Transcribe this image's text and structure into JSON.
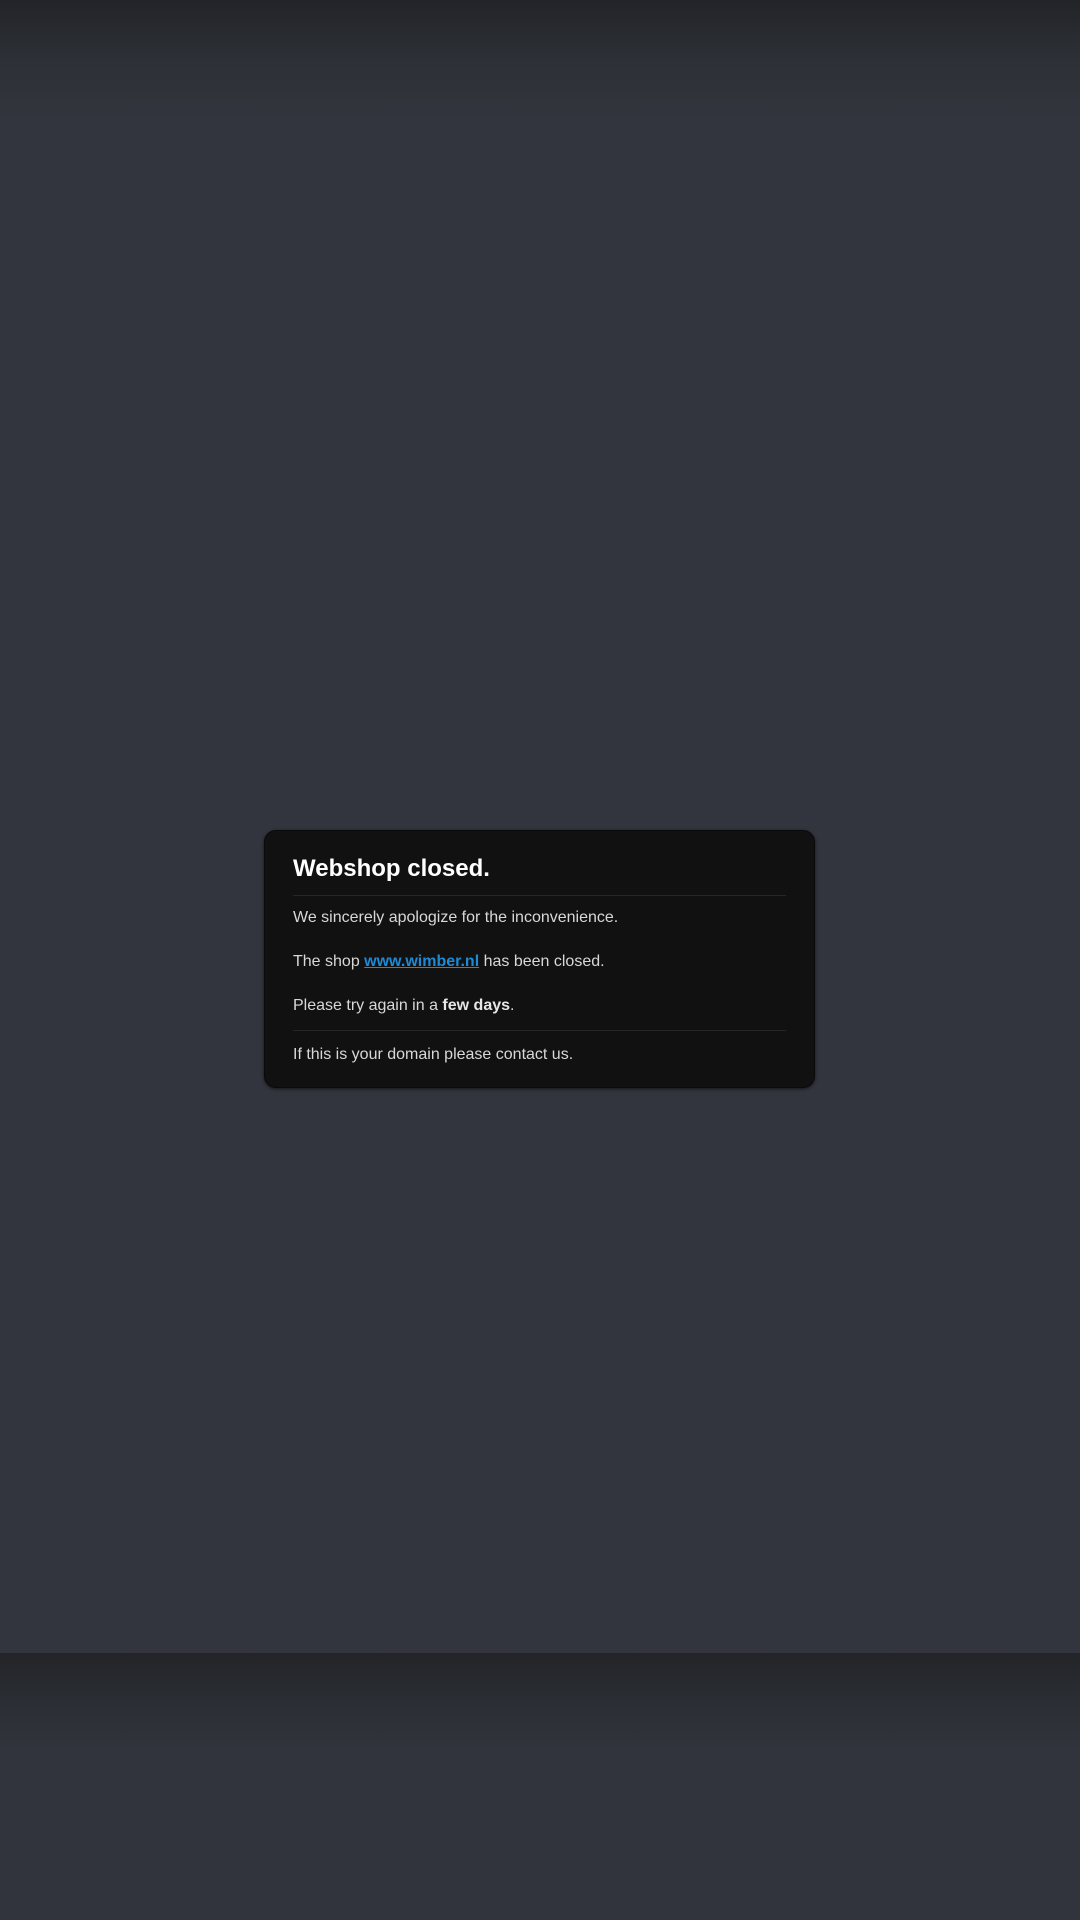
{
  "card": {
    "title": "Webshop closed.",
    "apology": "We sincerely apologize for the inconvenience.",
    "shop_line": {
      "prefix": "The shop ",
      "link_text": "www.wimber.nl",
      "suffix": " has been closed."
    },
    "retry_line": {
      "prefix": "Please try again in a ",
      "emphasis": "few days",
      "suffix": "."
    },
    "contact_text": "If this is your domain please contact us."
  },
  "colors": {
    "background": "#32353d",
    "card_background": "#111111",
    "link": "#1e8ad6",
    "title": "#ffffff",
    "text": "#d8d8d8"
  }
}
